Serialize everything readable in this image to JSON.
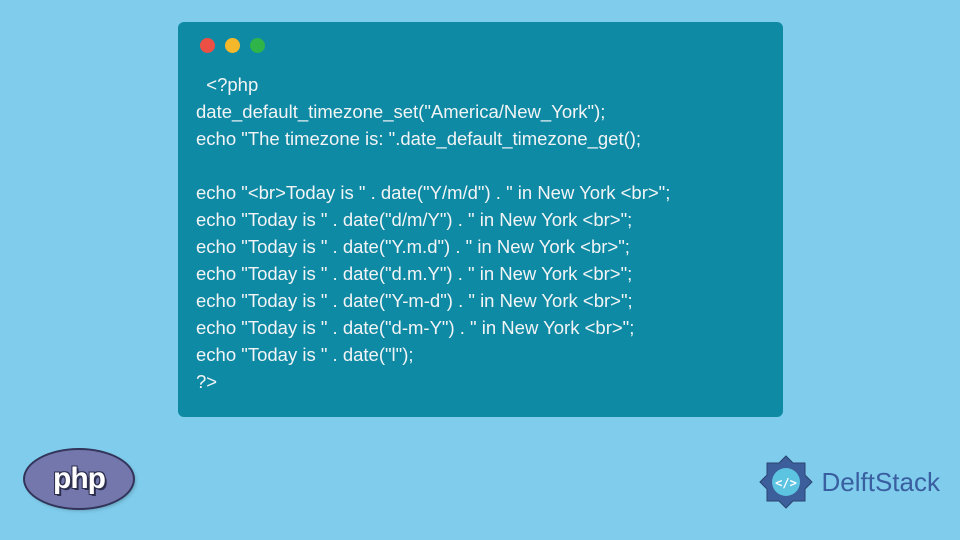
{
  "code_lines": [
    "  <?php",
    "date_default_timezone_set(\"America/New_York\");",
    "echo \"The timezone is: \".date_default_timezone_get();",
    "",
    "echo \"<br>Today is \" . date(\"Y/m/d\") . \" in New York <br>\";",
    "echo \"Today is \" . date(\"d/m/Y\") . \" in New York <br>\";",
    "echo \"Today is \" . date(\"Y.m.d\") . \" in New York <br>\";",
    "echo \"Today is \" . date(\"d.m.Y\") . \" in New York <br>\";",
    "echo \"Today is \" . date(\"Y-m-d\") . \" in New York <br>\";",
    "echo \"Today is \" . date(\"d-m-Y\") . \" in New York <br>\";",
    "echo \"Today is \" . date(\"l\");",
    "?>"
  ],
  "php_label": "php",
  "brand": "DelftStack"
}
